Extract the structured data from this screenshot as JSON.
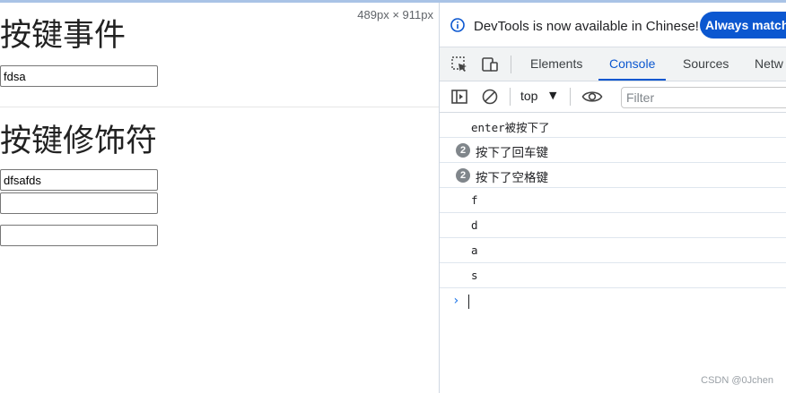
{
  "page": {
    "size_label": "489px × 911px",
    "heading_key_events": "按键事件",
    "input1_value": "fdsa",
    "heading_key_modifiers": "按键修饰符",
    "input2_value": "dfsafds",
    "input3_value": "",
    "input4_value": ""
  },
  "devtools": {
    "infobar": {
      "message": "DevTools is now available in Chinese!",
      "button": "Always match"
    },
    "tabs": [
      "Elements",
      "Console",
      "Sources",
      "Netw"
    ],
    "active_tab": "Console",
    "toolbar": {
      "context": "top",
      "filter_placeholder": "Filter"
    },
    "console_logs": [
      {
        "text": "enter被按下了",
        "count": null
      },
      {
        "text": "按下了回车键",
        "count": "2"
      },
      {
        "text": "按下了空格键",
        "count": "2"
      },
      {
        "text": "f",
        "count": null
      },
      {
        "text": "d",
        "count": null
      },
      {
        "text": "a",
        "count": null
      },
      {
        "text": "s",
        "count": null
      }
    ],
    "prompt_symbol": "›"
  },
  "watermark": "CSDN @0Jchen",
  "colors": {
    "accent": "#0b57d0",
    "badge": "#80868b"
  }
}
